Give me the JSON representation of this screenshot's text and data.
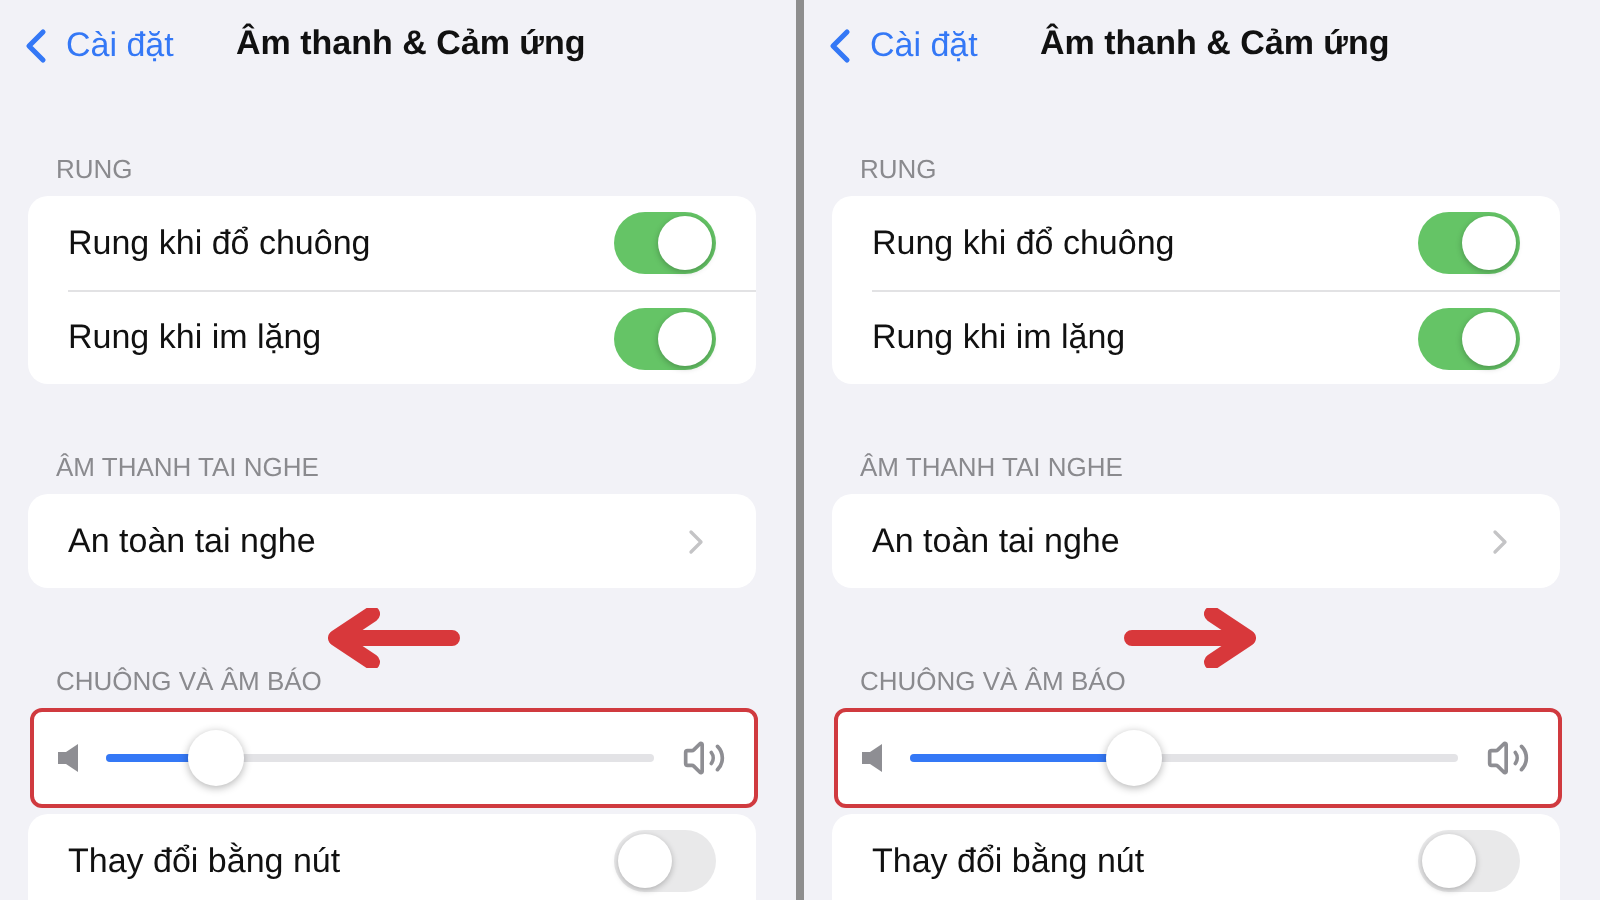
{
  "panels": [
    {
      "back_label": "Cài đặt",
      "title": "Âm thanh & Cảm ứng",
      "sections": [
        {
          "header": "RUNG",
          "rows": [
            {
              "kind": "toggle",
              "label": "Rung khi đổ chuông",
              "on": true
            },
            {
              "kind": "toggle",
              "label": "Rung khi im lặng",
              "on": true
            }
          ]
        },
        {
          "header": "ÂM THANH TAI NGHE",
          "rows": [
            {
              "kind": "link",
              "label": "An toàn tai nghe"
            }
          ]
        },
        {
          "header": "CHUÔNG VÀ ÂM BÁO",
          "arrow": {
            "kind": "left"
          },
          "rows": [
            {
              "kind": "slider",
              "level": 0.2,
              "highlighted": true
            },
            {
              "kind": "toggle",
              "label": "Thay đổi bằng nút",
              "on": false
            }
          ]
        }
      ]
    },
    {
      "back_label": "Cài đặt",
      "title": "Âm thanh & Cảm ứng",
      "sections": [
        {
          "header": "RUNG",
          "rows": [
            {
              "kind": "toggle",
              "label": "Rung khi đổ chuông",
              "on": true
            },
            {
              "kind": "toggle",
              "label": "Rung khi im lặng",
              "on": true
            }
          ]
        },
        {
          "header": "ÂM THANH TAI NGHE",
          "rows": [
            {
              "kind": "link",
              "label": "An toàn tai nghe"
            }
          ]
        },
        {
          "header": "CHUÔNG VÀ ÂM BÁO",
          "arrow": {
            "kind": "right"
          },
          "rows": [
            {
              "kind": "slider",
              "level": 0.41,
              "highlighted": true
            },
            {
              "kind": "toggle",
              "label": "Thay đổi bằng nút",
              "on": false
            }
          ]
        }
      ]
    }
  ]
}
